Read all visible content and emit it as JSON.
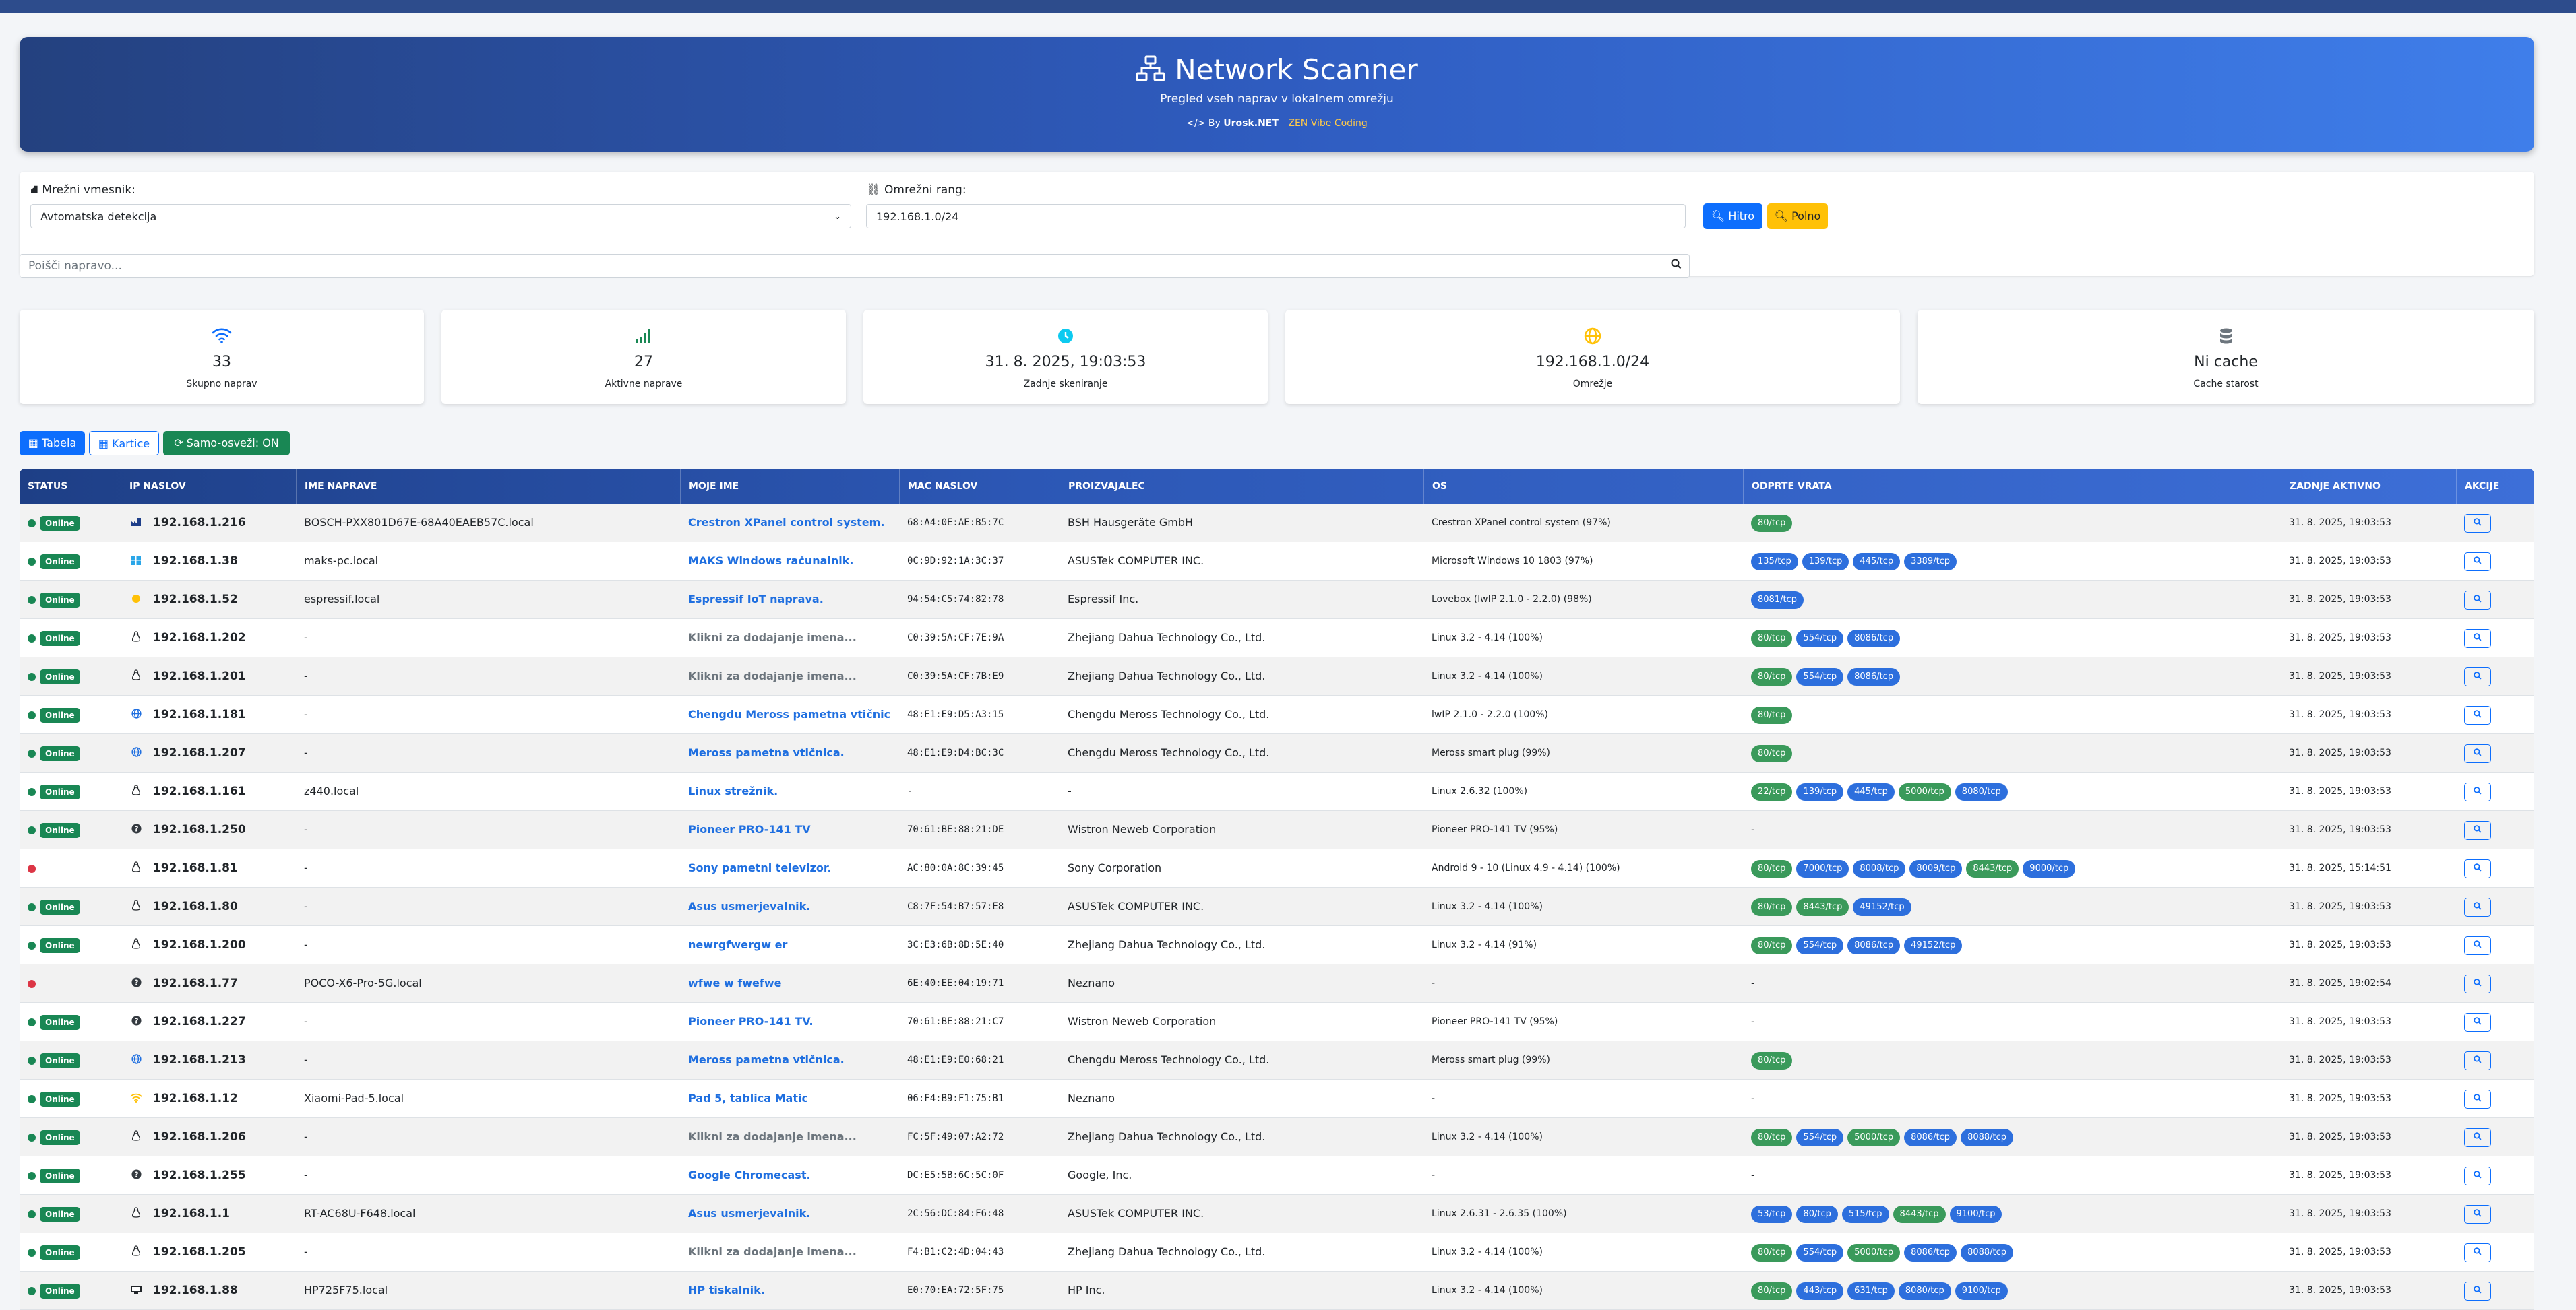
{
  "header": {
    "title": "Network Scanner",
    "subtitle": "Pregled vseh naprav v lokalnem omrežju",
    "by_prefix": "By",
    "by_name": "Urosk.NET",
    "zen": "ZEN Vibe Coding"
  },
  "controls": {
    "interface_label": "Mrežni vmesnik:",
    "interface_value": "Avtomatska detekcija",
    "range_label": "Omrežni rang:",
    "range_value": "192.168.1.0/24",
    "quick_button": "Hitro",
    "full_button": "Polno",
    "search_placeholder": "Poišči napravo..."
  },
  "stats": [
    {
      "icon": "wifi-icon",
      "value": "33",
      "label": "Skupno naprav",
      "color": "#0d6efd"
    },
    {
      "icon": "signal-icon",
      "value": "27",
      "label": "Aktivne naprave",
      "color": "#198754"
    },
    {
      "icon": "clock-icon",
      "value": "31. 8. 2025, 19:03:53",
      "label": "Zadnje skeniranje",
      "color": "#0dcaf0"
    },
    {
      "icon": "globe-icon",
      "value": "192.168.1.0/24",
      "label": "Omrežje",
      "color": "#ffc107"
    },
    {
      "icon": "database-icon",
      "value": "Ni cache",
      "label": "Cache starost",
      "color": "#6c757d"
    }
  ],
  "view": {
    "table_button": "Tabela",
    "cards_button": "Kartice",
    "auto_refresh_button": "Samo-osveži: ON"
  },
  "table": {
    "columns": [
      "STATUS",
      "IP NASLOV",
      "IME NAPRAVE",
      "MOJE IME",
      "MAC NASLOV",
      "PROIZVAJALEC",
      "OS",
      "ODPRTE VRATA",
      "ZADNJE AKTIVNO",
      "AKCIJE"
    ],
    "status_online_label": "Online",
    "rows": [
      {
        "online": true,
        "icon": "building-icon",
        "ip": "192.168.1.216",
        "hostname": "BOSCH-PXX801D67E-68A40EAEB57C.local",
        "myname": "Crestron XPanel control system.",
        "myname_placeholder": false,
        "mac": "68:A4:0E:AE:B5:7C",
        "vendor": "BSH Hausgeräte GmbH",
        "os": "Crestron XPanel control system (97%)",
        "ports": [
          "80/tcp"
        ],
        "last": "31. 8. 2025, 19:03:53"
      },
      {
        "online": true,
        "icon": "windows-icon",
        "ip": "192.168.1.38",
        "hostname": "maks-pc.local",
        "myname": "MAKS Windows računalnik.",
        "myname_placeholder": false,
        "mac": "0C:9D:92:1A:3C:37",
        "vendor": "ASUSTek COMPUTER INC.",
        "os": "Microsoft Windows 10 1803 (97%)",
        "ports": [
          "135/tcp",
          "139/tcp",
          "445/tcp",
          "3389/tcp"
        ],
        "last": "31. 8. 2025, 19:03:53"
      },
      {
        "online": true,
        "icon": "iot-icon",
        "ip": "192.168.1.52",
        "hostname": "espressif.local",
        "myname": "Espressif IoT naprava.",
        "myname_placeholder": false,
        "mac": "94:54:C5:74:82:78",
        "vendor": "Espressif Inc.",
        "os": "Lovebox (lwIP 2.1.0 - 2.2.0) (98%)",
        "ports": [
          "8081/tcp"
        ],
        "last": "31. 8. 2025, 19:03:53"
      },
      {
        "online": true,
        "icon": "linux-icon",
        "ip": "192.168.1.202",
        "hostname": "-",
        "myname": "Klikni za dodajanje imena...",
        "myname_placeholder": true,
        "mac": "C0:39:5A:CF:7E:9A",
        "vendor": "Zhejiang Dahua Technology Co., Ltd.",
        "os": "Linux 3.2 - 4.14 (100%)",
        "ports": [
          "80/tcp",
          "554/tcp",
          "8086/tcp"
        ],
        "last": "31. 8. 2025, 19:03:53"
      },
      {
        "online": true,
        "icon": "linux-icon",
        "ip": "192.168.1.201",
        "hostname": "-",
        "myname": "Klikni za dodajanje imena...",
        "myname_placeholder": true,
        "mac": "C0:39:5A:CF:7B:E9",
        "vendor": "Zhejiang Dahua Technology Co., Ltd.",
        "os": "Linux 3.2 - 4.14 (100%)",
        "ports": [
          "80/tcp",
          "554/tcp",
          "8086/tcp"
        ],
        "last": "31. 8. 2025, 19:03:53"
      },
      {
        "online": true,
        "icon": "globe-icon",
        "ip": "192.168.1.181",
        "hostname": "-",
        "myname": "Chengdu Meross pametna vtičnic",
        "myname_placeholder": false,
        "mac": "48:E1:E9:D5:A3:15",
        "vendor": "Chengdu Meross Technology Co., Ltd.",
        "os": "lwIP 2.1.0 - 2.2.0 (100%)",
        "ports": [
          "80/tcp"
        ],
        "last": "31. 8. 2025, 19:03:53"
      },
      {
        "online": true,
        "icon": "globe-icon",
        "ip": "192.168.1.207",
        "hostname": "-",
        "myname": "Meross pametna vtičnica.",
        "myname_placeholder": false,
        "mac": "48:E1:E9:D4:BC:3C",
        "vendor": "Chengdu Meross Technology Co., Ltd.",
        "os": "Meross smart plug (99%)",
        "ports": [
          "80/tcp"
        ],
        "last": "31. 8. 2025, 19:03:53"
      },
      {
        "online": true,
        "icon": "linux-icon",
        "ip": "192.168.1.161",
        "hostname": "z440.local",
        "myname": "Linux strežnik.",
        "myname_placeholder": false,
        "mac": "-",
        "vendor": "-",
        "os": "Linux 2.6.32 (100%)",
        "ports": [
          "22/tcp",
          "139/tcp",
          "445/tcp",
          "5000/tcp",
          "8080/tcp"
        ],
        "last": "31. 8. 2025, 19:03:53"
      },
      {
        "online": true,
        "icon": "question-icon",
        "ip": "192.168.1.250",
        "hostname": "-",
        "myname": "Pioneer PRO-141 TV",
        "myname_placeholder": false,
        "mac": "70:61:BE:88:21:DE",
        "vendor": "Wistron Neweb Corporation",
        "os": "Pioneer PRO-141 TV (95%)",
        "ports": [],
        "last": "31. 8. 2025, 19:03:53"
      },
      {
        "online": false,
        "icon": "linux-icon",
        "ip": "192.168.1.81",
        "hostname": "-",
        "myname": "Sony pametni televizor.",
        "myname_placeholder": false,
        "mac": "AC:80:0A:8C:39:45",
        "vendor": "Sony Corporation",
        "os": "Android 9 - 10 (Linux 4.9 - 4.14) (100%)",
        "ports": [
          "80/tcp",
          "7000/tcp",
          "8008/tcp",
          "8009/tcp",
          "8443/tcp",
          "9000/tcp"
        ],
        "last": "31. 8. 2025, 15:14:51"
      },
      {
        "online": true,
        "icon": "linux-icon",
        "ip": "192.168.1.80",
        "hostname": "-",
        "myname": "Asus usmerjevalnik.",
        "myname_placeholder": false,
        "mac": "C8:7F:54:B7:57:E8",
        "vendor": "ASUSTek COMPUTER INC.",
        "os": "Linux 3.2 - 4.14 (100%)",
        "ports": [
          "80/tcp",
          "8443/tcp",
          "49152/tcp"
        ],
        "last": "31. 8. 2025, 19:03:53"
      },
      {
        "online": true,
        "icon": "linux-icon",
        "ip": "192.168.1.200",
        "hostname": "-",
        "myname": "newrgfwergw er",
        "myname_placeholder": false,
        "mac": "3C:E3:6B:8D:5E:40",
        "vendor": "Zhejiang Dahua Technology Co., Ltd.",
        "os": "Linux 3.2 - 4.14 (91%)",
        "ports": [
          "80/tcp",
          "554/tcp",
          "8086/tcp",
          "49152/tcp"
        ],
        "last": "31. 8. 2025, 19:03:53"
      },
      {
        "online": false,
        "icon": "question-icon",
        "ip": "192.168.1.77",
        "hostname": "POCO-X6-Pro-5G.local",
        "myname": "wfwe w fwefwe",
        "myname_placeholder": false,
        "mac": "6E:40:EE:04:19:71",
        "vendor": "Neznano",
        "os": "-",
        "ports": [],
        "last": "31. 8. 2025, 19:02:54"
      },
      {
        "online": true,
        "icon": "question-icon",
        "ip": "192.168.1.227",
        "hostname": "-",
        "myname": "Pioneer PRO-141 TV.",
        "myname_placeholder": false,
        "mac": "70:61:BE:88:21:C7",
        "vendor": "Wistron Neweb Corporation",
        "os": "Pioneer PRO-141 TV (95%)",
        "ports": [],
        "last": "31. 8. 2025, 19:03:53"
      },
      {
        "online": true,
        "icon": "globe-icon",
        "ip": "192.168.1.213",
        "hostname": "-",
        "myname": "Meross pametna vtičnica.",
        "myname_placeholder": false,
        "mac": "48:E1:E9:E0:68:21",
        "vendor": "Chengdu Meross Technology Co., Ltd.",
        "os": "Meross smart plug (99%)",
        "ports": [
          "80/tcp"
        ],
        "last": "31. 8. 2025, 19:03:53"
      },
      {
        "online": true,
        "icon": "wifi-icon",
        "ip": "192.168.1.12",
        "hostname": "Xiaomi-Pad-5.local",
        "myname": "Pad 5, tablica Matic",
        "myname_placeholder": false,
        "mac": "06:F4:B9:F1:75:B1",
        "vendor": "Neznano",
        "os": "-",
        "ports": [],
        "last": "31. 8. 2025, 19:03:53"
      },
      {
        "online": true,
        "icon": "linux-icon",
        "ip": "192.168.1.206",
        "hostname": "-",
        "myname": "Klikni za dodajanje imena...",
        "myname_placeholder": true,
        "mac": "FC:5F:49:07:A2:72",
        "vendor": "Zhejiang Dahua Technology Co., Ltd.",
        "os": "Linux 3.2 - 4.14 (100%)",
        "ports": [
          "80/tcp",
          "554/tcp",
          "5000/tcp",
          "8086/tcp",
          "8088/tcp"
        ],
        "last": "31. 8. 2025, 19:03:53"
      },
      {
        "online": true,
        "icon": "question-icon",
        "ip": "192.168.1.255",
        "hostname": "-",
        "myname": "Google Chromecast.",
        "myname_placeholder": false,
        "mac": "DC:E5:5B:6C:5C:0F",
        "vendor": "Google, Inc.",
        "os": "-",
        "ports": [],
        "last": "31. 8. 2025, 19:03:53"
      },
      {
        "online": true,
        "icon": "linux-icon",
        "ip": "192.168.1.1",
        "hostname": "RT-AC68U-F648.local",
        "myname": "Asus usmerjevalnik.",
        "myname_placeholder": false,
        "mac": "2C:56:DC:84:F6:48",
        "vendor": "ASUSTek COMPUTER INC.",
        "os": "Linux 2.6.31 - 2.6.35 (100%)",
        "ports": [
          "53/tcp",
          "80/tcp",
          "515/tcp",
          "8443/tcp",
          "9100/tcp"
        ],
        "last": "31. 8. 2025, 19:03:53"
      },
      {
        "online": true,
        "icon": "linux-icon",
        "ip": "192.168.1.205",
        "hostname": "-",
        "myname": "Klikni za dodajanje imena...",
        "myname_placeholder": true,
        "mac": "F4:B1:C2:4D:04:43",
        "vendor": "Zhejiang Dahua Technology Co., Ltd.",
        "os": "Linux 3.2 - 4.14 (100%)",
        "ports": [
          "80/tcp",
          "554/tcp",
          "5000/tcp",
          "8086/tcp",
          "8088/tcp"
        ],
        "last": "31. 8. 2025, 19:03:53"
      },
      {
        "online": true,
        "icon": "printer-icon",
        "ip": "192.168.1.88",
        "hostname": "HP725F75.local",
        "myname": "HP tiskalnik.",
        "myname_placeholder": false,
        "mac": "E0:70:EA:72:5F:75",
        "vendor": "HP Inc.",
        "os": "Linux 3.2 - 4.14 (100%)",
        "ports": [
          "80/tcp",
          "443/tcp",
          "631/tcp",
          "8080/tcp",
          "9100/tcp"
        ],
        "last": "31. 8. 2025, 19:03:53"
      }
    ]
  },
  "colors": {
    "accent": "#0d6efd",
    "online": "#198754",
    "offline": "#dc3545",
    "port_green": "#3a9a5b",
    "port_blue": "#2d6fdd",
    "header_gradient_start": "#24417f",
    "header_gradient_end": "#3f7eea"
  }
}
